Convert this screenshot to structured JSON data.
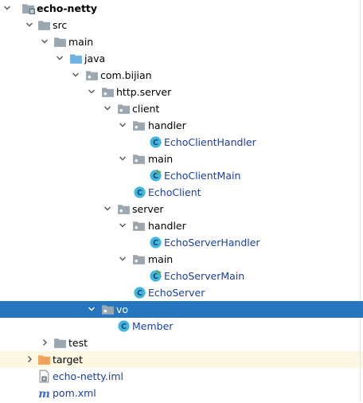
{
  "tree": {
    "root": {
      "label": "echo-netty"
    },
    "src": {
      "label": "src"
    },
    "main": {
      "label": "main"
    },
    "java": {
      "label": "java"
    },
    "pkg": {
      "label": "com.bijian"
    },
    "http": {
      "label": "http.server"
    },
    "client": {
      "label": "client"
    },
    "client_handler": {
      "label": "handler"
    },
    "echo_client_handler": {
      "label": "EchoClientHandler"
    },
    "client_main": {
      "label": "main"
    },
    "echo_client_main": {
      "label": "EchoClientMain"
    },
    "echo_client": {
      "label": "EchoClient"
    },
    "server": {
      "label": "server"
    },
    "server_handler": {
      "label": "handler"
    },
    "echo_server_handler": {
      "label": "EchoServerHandler"
    },
    "server_main": {
      "label": "main"
    },
    "echo_server_main": {
      "label": "EchoServerMain"
    },
    "echo_server": {
      "label": "EchoServer"
    },
    "vo": {
      "label": "vo"
    },
    "member": {
      "label": "Member"
    },
    "test": {
      "label": "test"
    },
    "target": {
      "label": "target"
    },
    "iml": {
      "label": "echo-netty.iml"
    },
    "pom": {
      "label": "pom.xml"
    }
  },
  "colors": {
    "selection": "#2675bf",
    "excluded_bg": "#fbf7e3",
    "class_text": "#1b3fa7",
    "folder_gray": "#9aa7b0",
    "source_folder_blue": "#6fb2e2",
    "excluded_folder_orange": "#f0a35a",
    "class_icon": "#40b6e0"
  },
  "icons": {
    "expanded": "chevron-down-icon",
    "collapsed": "chevron-right-icon",
    "module": "module-folder-icon",
    "folder": "folder-icon",
    "source_folder": "source-folder-icon",
    "package": "package-icon",
    "class": "class-icon",
    "runnable_class": "runnable-class-icon",
    "excluded_folder": "excluded-folder-icon",
    "iml_file": "iml-file-icon",
    "maven_file": "maven-file-icon"
  }
}
